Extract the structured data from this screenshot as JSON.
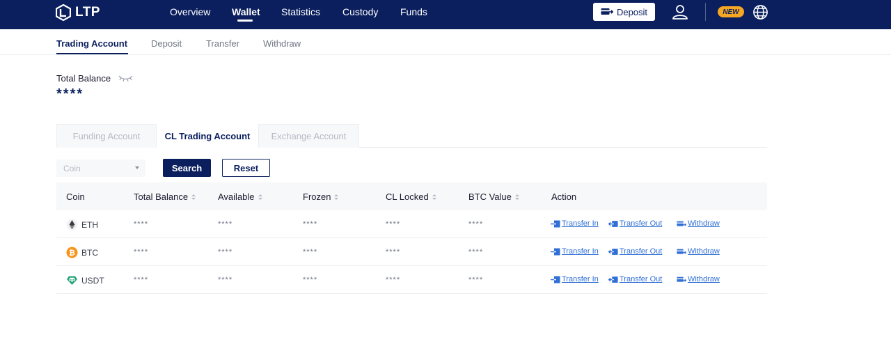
{
  "brand": {
    "name": "LTP"
  },
  "nav": {
    "items": [
      {
        "label": "Overview"
      },
      {
        "label": "Wallet"
      },
      {
        "label": "Statistics"
      },
      {
        "label": "Custody"
      },
      {
        "label": "Funds"
      }
    ],
    "active": "Wallet",
    "deposit_label": "Deposit",
    "new_badge": "NEW"
  },
  "subnav": {
    "tabs": [
      {
        "label": "Trading Account"
      },
      {
        "label": "Deposit"
      },
      {
        "label": "Transfer"
      },
      {
        "label": "Withdraw"
      }
    ],
    "active": "Trading Account"
  },
  "balance": {
    "label": "Total Balance",
    "value": "****"
  },
  "account_tabs": {
    "tabs": [
      {
        "label": "Funding Account"
      },
      {
        "label": "CL Trading Account"
      },
      {
        "label": "Exchange Account"
      }
    ],
    "active": "CL Trading Account"
  },
  "filter": {
    "coin_placeholder": "Coin",
    "search_label": "Search",
    "reset_label": "Reset"
  },
  "table": {
    "columns": [
      "Coin",
      "Total Balance",
      "Available",
      "Frozen",
      "CL Locked",
      "BTC Value",
      "Action"
    ],
    "rows": [
      {
        "coin": "ETH",
        "icon": "eth-icon",
        "total": "****",
        "available": "****",
        "frozen": "****",
        "locked": "****",
        "btc": "****"
      },
      {
        "coin": "BTC",
        "icon": "btc-icon",
        "total": "****",
        "available": "****",
        "frozen": "****",
        "locked": "****",
        "btc": "****"
      },
      {
        "coin": "USDT",
        "icon": "usdt-icon",
        "total": "****",
        "available": "****",
        "frozen": "****",
        "locked": "****",
        "btc": "****"
      }
    ],
    "actions": {
      "transfer_in": "Transfer In",
      "transfer_out": "Transfer Out",
      "withdraw": "Withdraw"
    }
  },
  "colors": {
    "navy": "#0b1f5e",
    "link": "#2f6fd6",
    "badge": "#f5a623",
    "btc": "#f7931a",
    "usdt": "#26a17b"
  }
}
